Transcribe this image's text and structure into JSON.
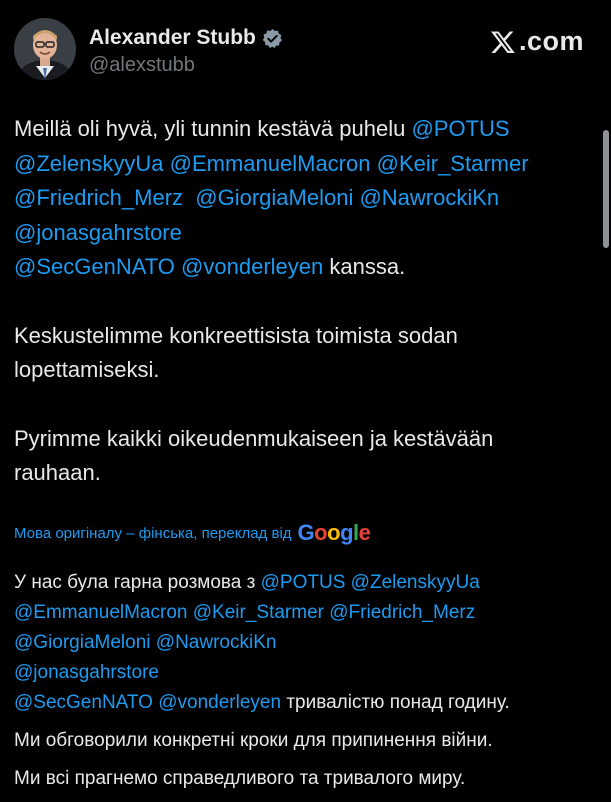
{
  "header": {
    "display_name": "Alexander Stubb",
    "handle": "@alexstubb",
    "brand_text": ".com",
    "brand_icon": "x-logo-icon",
    "verified_icon": "verified-badge-icon"
  },
  "tweet": {
    "p1_intro": "Meillä oli hyvä, yli tunnin kestävä puhelu ",
    "p1_mentions": [
      "@POTUS",
      "@ZelenskyyUa",
      "@EmmanuelMacron",
      "@Keir_Starmer",
      "@Friedrich_Merz",
      "@GiorgiaMeloni",
      "@NawrockiKn",
      "@jonasgahrstore",
      "@SecGenNATO",
      "@vonderleyen"
    ],
    "p1_outro": " kanssa.",
    "p2": "Keskustelimme konkreettisista toimista sodan lopettamiseksi.",
    "p3": "Pyrimme kaikki oikeudenmukaiseen ja kestävään rauhaan."
  },
  "translation_bar": {
    "label": "Мова оригіналу – фінська, переклад від",
    "provider": "Google"
  },
  "translation": {
    "p1_intro": "У нас була гарна розмова з ",
    "p1_outro": " тривалістю понад годину.",
    "p2": "Ми обговорили конкретні кроки для припинення війни.",
    "p3": "Ми всі прагнемо справедливого та тривалого миру."
  },
  "colors": {
    "background": "#000000",
    "text": "#e7e9ea",
    "secondary": "#71767b",
    "accent": "#1d9bf0"
  }
}
